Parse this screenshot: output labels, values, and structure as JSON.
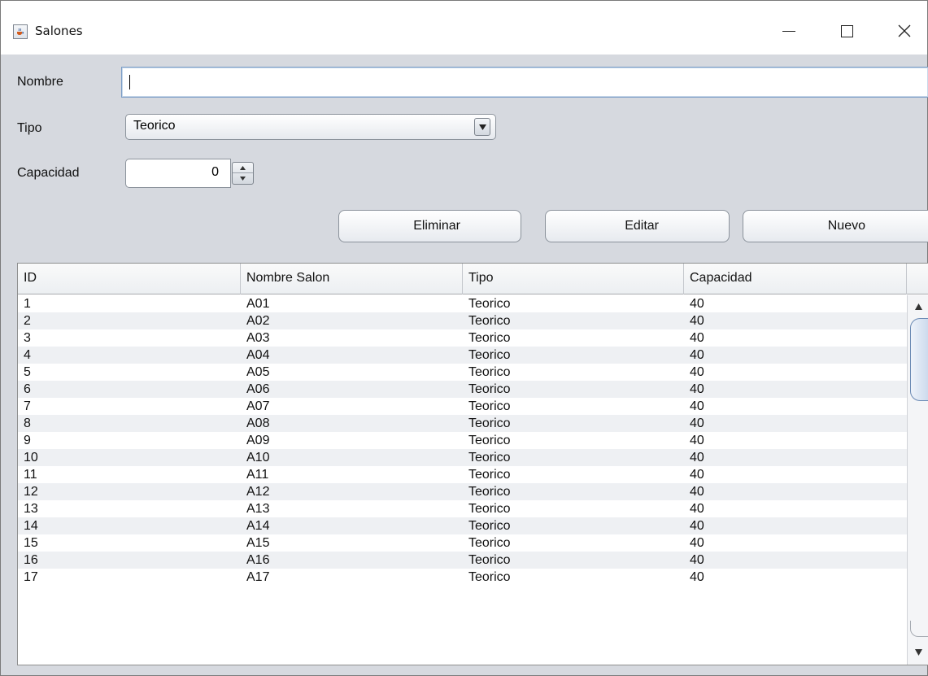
{
  "window": {
    "title": "Salones",
    "controls": {
      "minimize": "minimize-icon",
      "maximize": "maximize-icon",
      "close": "close-icon"
    }
  },
  "form": {
    "nombre_label": "Nombre",
    "nombre_value": "",
    "tipo_label": "Tipo",
    "tipo_selected": "Teorico",
    "capacidad_label": "Capacidad",
    "capacidad_value": "0"
  },
  "buttons": {
    "eliminar": "Eliminar",
    "editar": "Editar",
    "nuevo": "Nuevo"
  },
  "table": {
    "columns": [
      "ID",
      "Nombre Salon",
      "Tipo",
      "Capacidad"
    ],
    "rows": [
      [
        "1",
        "A01",
        "Teorico",
        "40"
      ],
      [
        "2",
        "A02",
        "Teorico",
        "40"
      ],
      [
        "3",
        "A03",
        "Teorico",
        "40"
      ],
      [
        "4",
        "A04",
        "Teorico",
        "40"
      ],
      [
        "5",
        "A05",
        "Teorico",
        "40"
      ],
      [
        "6",
        "A06",
        "Teorico",
        "40"
      ],
      [
        "7",
        "A07",
        "Teorico",
        "40"
      ],
      [
        "8",
        "A08",
        "Teorico",
        "40"
      ],
      [
        "9",
        "A09",
        "Teorico",
        "40"
      ],
      [
        "10",
        "A10",
        "Teorico",
        "40"
      ],
      [
        "11",
        "A11",
        "Teorico",
        "40"
      ],
      [
        "12",
        "A12",
        "Teorico",
        "40"
      ],
      [
        "13",
        "A13",
        "Teorico",
        "40"
      ],
      [
        "14",
        "A14",
        "Teorico",
        "40"
      ],
      [
        "15",
        "A15",
        "Teorico",
        "40"
      ],
      [
        "16",
        "A16",
        "Teorico",
        "40"
      ],
      [
        "17",
        "A17",
        "Teorico",
        "40"
      ]
    ]
  }
}
